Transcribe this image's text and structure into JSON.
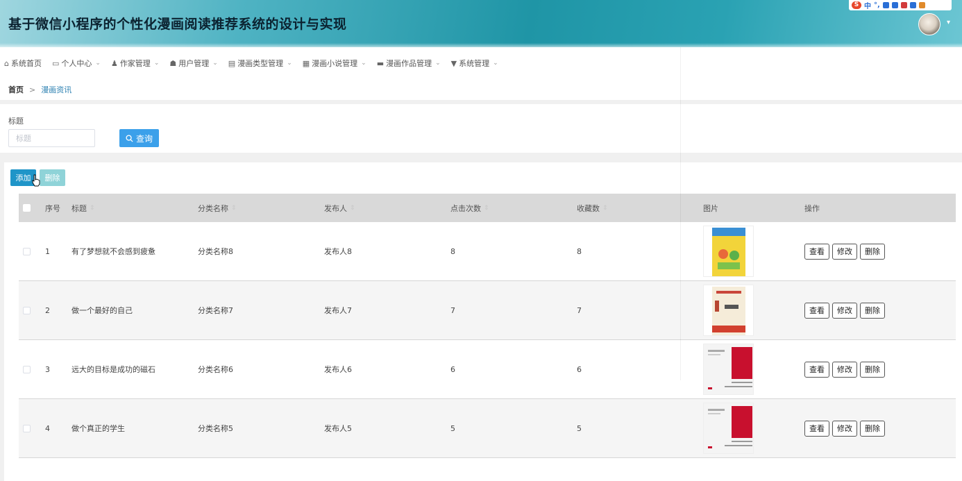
{
  "header": {
    "title": "基于微信小程序的个性化漫画阅读推荐系统的设计与实现",
    "ime": {
      "logo": "S",
      "label": "中",
      "punct": "°,"
    }
  },
  "nav": [
    {
      "label": "系统首页",
      "icon": "home-icon",
      "glyph": "⌂",
      "caret": false
    },
    {
      "label": "个人中心",
      "icon": "user-card-icon",
      "glyph": "▭",
      "caret": true
    },
    {
      "label": "作家管理",
      "icon": "person-icon",
      "glyph": "♟",
      "caret": true
    },
    {
      "label": "用户管理",
      "icon": "users-icon",
      "glyph": "☗",
      "caret": true
    },
    {
      "label": "漫画类型管理",
      "icon": "list-icon",
      "glyph": "▤",
      "caret": true
    },
    {
      "label": "漫画小说管理",
      "icon": "grid-icon",
      "glyph": "▦",
      "caret": true
    },
    {
      "label": "漫画作品管理",
      "icon": "chat-icon",
      "glyph": "▬",
      "caret": true
    },
    {
      "label": "系统管理",
      "icon": "settings-icon",
      "glyph": "▼",
      "caret": true
    }
  ],
  "breadcrumb": {
    "home": "首页",
    "separator": ">",
    "current": "漫画资讯"
  },
  "search": {
    "label": "标题",
    "placeholder": "标题",
    "button": "查询"
  },
  "toolbar": {
    "add": "添加",
    "delete": "删除"
  },
  "table": {
    "headers": {
      "index": "序号",
      "title": "标题",
      "category": "分类名称",
      "publisher": "发布人",
      "clicks": "点击次数",
      "favorites": "收藏数",
      "image": "图片",
      "actions": "操作"
    },
    "actions": {
      "view": "查看",
      "edit": "修改",
      "delete": "删除"
    },
    "rows": [
      {
        "index": "1",
        "title": "有了梦想就不会感到疲惫",
        "category": "分类名称8",
        "publisher": "发布人8",
        "clicks": "8",
        "favorites": "8",
        "cover": "cover-yellow"
      },
      {
        "index": "2",
        "title": "做一个最好的自己",
        "category": "分类名称7",
        "publisher": "发布人7",
        "clicks": "7",
        "favorites": "7",
        "cover": "cover-cream"
      },
      {
        "index": "3",
        "title": "远大的目标是成功的磁石",
        "category": "分类名称6",
        "publisher": "发布人6",
        "clicks": "6",
        "favorites": "6",
        "cover": "cover-red"
      },
      {
        "index": "4",
        "title": "做个真正的学生",
        "category": "分类名称5",
        "publisher": "发布人5",
        "clicks": "5",
        "favorites": "5",
        "cover": "cover-red"
      }
    ]
  },
  "colors": {
    "primary": "#1f95c8",
    "search": "#3ba0ea",
    "disabled": "#8fd3d8",
    "header": "#1f95a6"
  }
}
